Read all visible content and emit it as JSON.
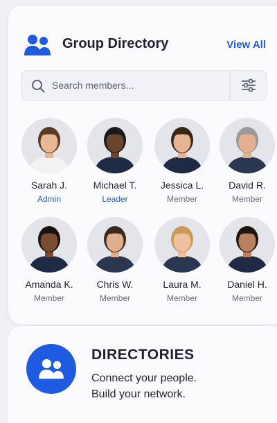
{
  "header": {
    "title": "Group Directory",
    "view_all": "View All",
    "icon": "people-group-icon",
    "accent_color": "#1f5be0"
  },
  "search": {
    "placeholder": "Search members...",
    "icon": "search-icon",
    "filter_icon": "sliders-icon"
  },
  "members": [
    {
      "name": "Sarah J.",
      "role": "Admin",
      "accent": true,
      "hair": "#5a3a22",
      "skin": "#e8b896",
      "shirt": "#f2f2f2"
    },
    {
      "name": "Michael T.",
      "role": "Leader",
      "accent": true,
      "hair": "#1a1a1a",
      "skin": "#6b4430",
      "shirt": "#1f2a44"
    },
    {
      "name": "Jessica L.",
      "role": "Member",
      "accent": false,
      "hair": "#3a2618",
      "skin": "#e6b493",
      "shirt": "#1f2a44"
    },
    {
      "name": "David R.",
      "role": "Member",
      "accent": false,
      "hair": "#9a9a9a",
      "skin": "#e3b191",
      "shirt": "#2b3650"
    },
    {
      "name": "Amanda K.",
      "role": "Member",
      "accent": false,
      "hair": "#1a120c",
      "skin": "#7a4d33",
      "shirt": "#1f2a44"
    },
    {
      "name": "Chris W.",
      "role": "Member",
      "accent": false,
      "hair": "#3b2a1d",
      "skin": "#e0ad8d",
      "shirt": "#2b3650"
    },
    {
      "name": "Laura M.",
      "role": "Member",
      "accent": false,
      "hair": "#c79a5a",
      "skin": "#eec0a0",
      "shirt": "#2b3650"
    },
    {
      "name": "Daniel H.",
      "role": "Member",
      "accent": false,
      "hair": "#1f1610",
      "skin": "#b98061",
      "shirt": "#1f2a44"
    }
  ],
  "banner": {
    "title": "DIRECTORIES",
    "line1": "Connect your people.",
    "line2": "Build your network.",
    "icon": "people-group-icon"
  }
}
